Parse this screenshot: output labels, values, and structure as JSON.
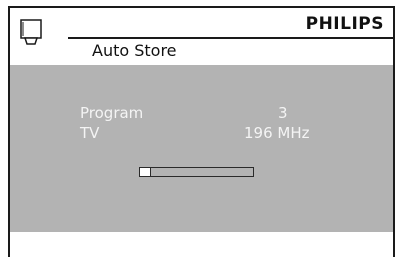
{
  "window": {
    "brand": "PHILIPS",
    "title": "Auto Store",
    "icon": "tv-icon"
  },
  "search": {
    "program_label": "Program",
    "program_value": "3",
    "band_label": "TV",
    "frequency": "196 MHz",
    "progress_fraction": 0.1
  },
  "colors": {
    "panel": "#b3b3b3",
    "text_light": "#f4f4f4",
    "frame": "#1a1a1a"
  }
}
